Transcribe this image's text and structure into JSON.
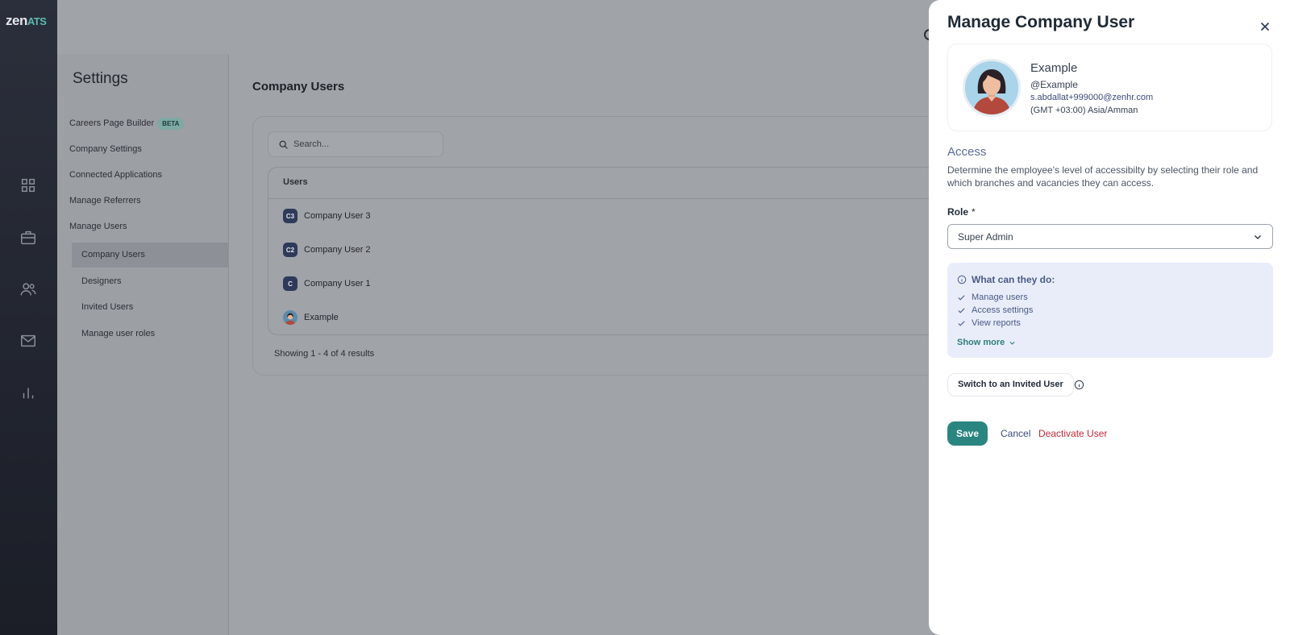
{
  "app": {
    "logo_main": "zen",
    "logo_suffix": "ATS"
  },
  "rail": {
    "icons": [
      "grid-icon",
      "briefcase-icon",
      "people-icon",
      "mail-icon",
      "bar-chart-icon"
    ]
  },
  "settings": {
    "title": "Settings",
    "items": [
      {
        "label": "Careers Page Builder",
        "badge": "BETA"
      },
      {
        "label": "Company Settings"
      },
      {
        "label": "Connected Applications"
      },
      {
        "label": "Manage Referrers"
      },
      {
        "label": "Manage Users"
      }
    ],
    "sub_items": [
      {
        "label": "Company Users",
        "active": true
      },
      {
        "label": "Designers"
      },
      {
        "label": "Invited Users"
      },
      {
        "label": "Manage user roles"
      }
    ]
  },
  "main": {
    "title": "Company Users",
    "search_placeholder": "Search...",
    "table": {
      "header": "Users",
      "rows": [
        {
          "initials": "C3",
          "name": "Company User 3"
        },
        {
          "initials": "C2",
          "name": "Company User 2"
        },
        {
          "initials": "C",
          "name": "Company User 1"
        },
        {
          "initials": "",
          "name": "Example",
          "avatar": true
        }
      ]
    },
    "footer": "Showing 1 - 4 of 4 results"
  },
  "drawer": {
    "title": "Manage Company User",
    "profile": {
      "name": "Example",
      "handle": "@Example",
      "email": "s.abdallat+999000@zenhr.com",
      "timezone": "(GMT +03:00) Asia/Amman"
    },
    "access": {
      "heading": "Access",
      "description": "Determine the employee's level of accessibilty by selecting their role and which branches and vacancies they can access."
    },
    "role": {
      "label": "Role",
      "required_mark": "*",
      "value": "Super Admin"
    },
    "permissions": {
      "heading": "What can they do:",
      "items": [
        "Manage users",
        "Access settings",
        "View reports"
      ],
      "show_more": "Show more"
    },
    "switch_button": "Switch to an Invited User",
    "save": "Save",
    "cancel": "Cancel",
    "deactivate": "Deactivate User"
  },
  "colors": {
    "accent": "#2a8580",
    "danger": "#c62839",
    "link": "#3b4a7a",
    "info_bg": "#e9edfa"
  }
}
